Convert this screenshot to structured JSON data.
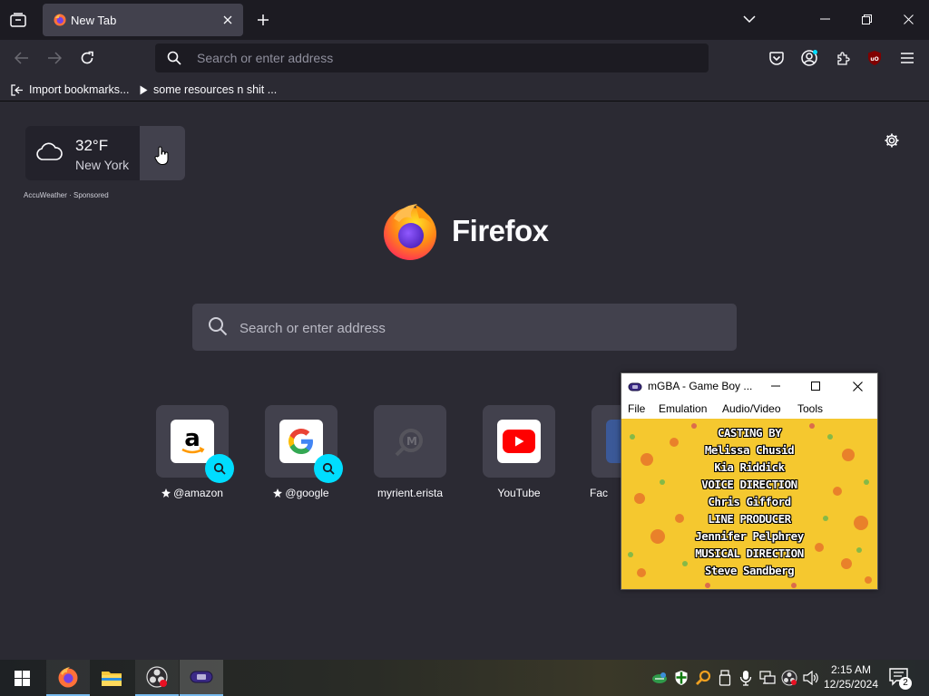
{
  "tab": {
    "title": "New Tab"
  },
  "urlbar": {
    "placeholder": "Search or enter address"
  },
  "bookmarks": [
    {
      "label": "Import bookmarks..."
    },
    {
      "label": "some resources n shit ..."
    }
  ],
  "weather": {
    "temp": "32°F",
    "city": "New York",
    "sponsor": "AccuWeather · Sponsored"
  },
  "logo": {
    "wordmark": "Firefox"
  },
  "search": {
    "placeholder": "Search or enter address"
  },
  "topsites": [
    {
      "label": "@amazon",
      "pinned": true
    },
    {
      "label": "@google",
      "pinned": true
    },
    {
      "label": "myrient.erista",
      "pinned": false
    },
    {
      "label": "YouTube",
      "pinned": false
    },
    {
      "label": "Fac",
      "pinned": false
    }
  ],
  "mgba": {
    "title": "mGBA - Game Boy ...",
    "menu": [
      "File",
      "Emulation",
      "Audio/Video",
      "Tools"
    ],
    "credits": [
      "CASTING BY",
      "Melissa Chusid",
      "Kia Riddick",
      "VOICE DIRECTION",
      "Chris Gifford",
      "LINE PRODUCER",
      "Jennifer Pelphrey",
      "MUSICAL DIRECTION",
      "Steve Sandberg"
    ]
  },
  "taskbar": {
    "time": "2:15 AM",
    "date": "12/25/2024",
    "notifications": "2"
  },
  "colors": {
    "accent": "#00ddff",
    "background": "#2b2a33",
    "tabstrip": "#1c1b22",
    "card": "#42414d",
    "emulator_bg": "#f5c82f"
  }
}
